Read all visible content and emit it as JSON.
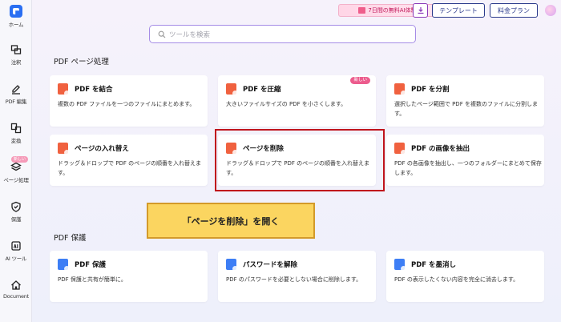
{
  "sidebar": {
    "items": [
      {
        "label": "ホーム",
        "icon": "logo-icon"
      },
      {
        "label": "注釈",
        "icon": "annotation-icon"
      },
      {
        "label": "PDF 編集",
        "icon": "edit-icon"
      },
      {
        "label": "変換",
        "icon": "convert-icon"
      },
      {
        "label": "ページ処理",
        "icon": "layers-icon",
        "badge": "新しい"
      },
      {
        "label": "保護",
        "icon": "shield-icon"
      },
      {
        "label": "AI ツール",
        "icon": "ai-icon"
      },
      {
        "label": "Document",
        "icon": "home-icon"
      }
    ]
  },
  "topbar": {
    "promo": "7日間の無料AI体験！",
    "template_label": "テンプレート",
    "pricing_label": "料金プラン"
  },
  "search": {
    "placeholder": "ツールを検索"
  },
  "sections": [
    {
      "title": "PDF ページ処理",
      "cards": [
        {
          "title": "PDF を結合",
          "desc": "複数の PDF ファイルを一つのファイルにまとめます。",
          "icon_color": "#f0613f"
        },
        {
          "title": "PDF を圧縮",
          "desc": "大きいファイルサイズの PDF を小さくします。",
          "icon_color": "#f0613f",
          "badge": "新しい"
        },
        {
          "title": "PDF を分割",
          "desc": "選択したページ範囲で PDF を複数のファイルに分割します。",
          "icon_color": "#f0613f"
        },
        {
          "title": "ページの入れ替え",
          "desc": "ドラッグ＆ドロップで PDF のページの順番を入れ替えます。",
          "icon_color": "#f0613f"
        },
        {
          "title": "ページを削除",
          "desc": "ドラッグ＆ドロップで PDF のページの順番を入れ替えます。",
          "icon_color": "#f0613f"
        },
        {
          "title": "PDF の画像を抽出",
          "desc": "PDF の各画像を抽出し、一つのフォルダーにまとめて保存します。",
          "icon_color": "#f0613f"
        }
      ]
    },
    {
      "title": "PDF 保護",
      "cards": [
        {
          "title": "PDF 保護",
          "desc": "PDF 保護と共有が簡単に。",
          "icon_color": "#3d7ef5"
        },
        {
          "title": "パスワードを解除",
          "desc": "PDF のパスワードを必要としない場合に削除します。",
          "icon_color": "#3d7ef5"
        },
        {
          "title": "PDF を墨消し",
          "desc": "PDF の表示したくない内容を完全に消去します。",
          "icon_color": "#3d7ef5"
        }
      ]
    }
  ],
  "callout": "「ページを削除」を開く",
  "colors": {
    "highlight_border": "#c0141c",
    "callout_bg": "#fbd560",
    "accent": "#2b3a8c"
  }
}
